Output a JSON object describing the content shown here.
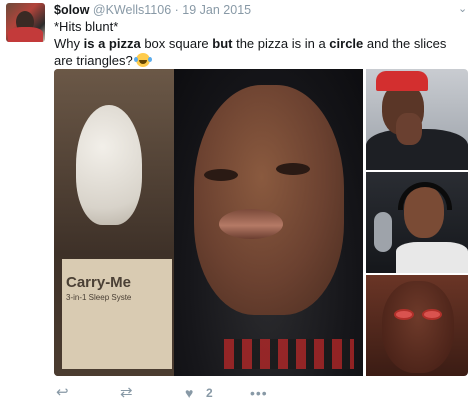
{
  "tweet": {
    "display_name": "$olow",
    "handle": "@KWells1106",
    "separator": "·",
    "date": "19 Jan 2015",
    "text": {
      "line0": "*Hits blunt*",
      "p1": "Why ",
      "b1": "is a pizza",
      "p2": " box square ",
      "b2": "but",
      "p3": " the pizza is in a ",
      "b3": "circle",
      "p4": " and the slices are triangles? "
    },
    "emoji": "tears-of-joy-emoji"
  },
  "media": {
    "main_image_text": {
      "box_label": "Carry-Me",
      "box_sub": "3-in-1 Sleep Syste"
    },
    "images": [
      "hood-up-face-photo",
      "red-cap-man-photo",
      "headphones-studio-photo",
      "red-eyes-face-photo"
    ]
  },
  "actions": {
    "reply_icon": "reply-icon",
    "retweet_icon": "retweet-icon",
    "like_icon": "heart-icon",
    "like_count": "2",
    "more_icon": "more-icon"
  },
  "colors": {
    "text": "#14171a",
    "secondary": "#8899a6"
  }
}
